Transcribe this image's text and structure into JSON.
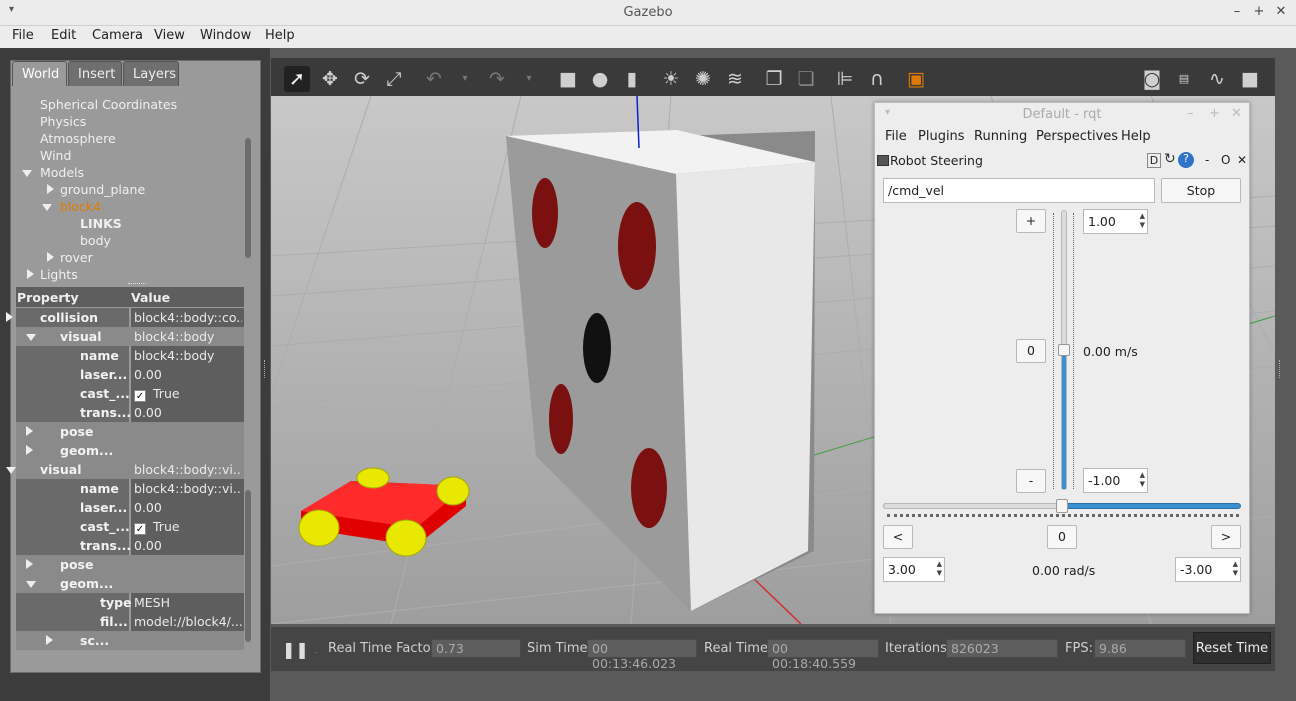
{
  "window": {
    "title": "Gazebo"
  },
  "menu": [
    "File",
    "Edit",
    "Camera",
    "View",
    "Window",
    "Help"
  ],
  "left_tabs": [
    "World",
    "Insert",
    "Layers"
  ],
  "tree": {
    "items": [
      "Spherical Coordinates",
      "Physics",
      "Atmosphere",
      "Wind",
      "Models",
      "ground_plane",
      "block4",
      "LINKS",
      "body",
      "rover",
      "Lights"
    ]
  },
  "props": {
    "header_property": "Property",
    "header_value": "Value",
    "rows": [
      {
        "k": "collision",
        "v": "block4::body::co..."
      },
      {
        "k": "visual",
        "v": "block4::body"
      },
      {
        "k": "name",
        "v": "block4::body"
      },
      {
        "k": "laser...",
        "v": "0.00"
      },
      {
        "k": "cast_...",
        "v": "True"
      },
      {
        "k": "trans...",
        "v": "0.00"
      },
      {
        "k": "pose",
        "v": ""
      },
      {
        "k": "geom...",
        "v": ""
      },
      {
        "k": "visual",
        "v": "block4::body::vi..."
      },
      {
        "k": "name",
        "v": "block4::body::vi..."
      },
      {
        "k": "laser...",
        "v": "0.00"
      },
      {
        "k": "cast_...",
        "v": "True"
      },
      {
        "k": "trans...",
        "v": "0.00"
      },
      {
        "k": "pose",
        "v": ""
      },
      {
        "k": "geom...",
        "v": ""
      },
      {
        "k": "type",
        "v": "MESH"
      },
      {
        "k": "fil...",
        "v": "model://block4/..."
      },
      {
        "k": "sc...",
        "v": ""
      }
    ]
  },
  "bottom": {
    "rtf_label": "Real Time Factor:",
    "rtf": "0.73",
    "sim_label": "Sim Time:",
    "sim": "00 00:13:46.023",
    "real_label": "Real Time:",
    "real": "00 00:18:40.559",
    "iter_label": "Iterations:",
    "iter": "826023",
    "fps_label": "FPS:",
    "fps": "9.86",
    "reset": "Reset Time"
  },
  "rqt": {
    "title": "Default - rqt",
    "menu": [
      "File",
      "Plugins",
      "Running",
      "Perspectives",
      "Help"
    ],
    "plugin": "Robot Steering",
    "topic": "/cmd_vel",
    "stop": "Stop",
    "plus": "+",
    "minus": "-",
    "zero": "0",
    "max_lin": "1.00",
    "min_lin": "-1.00",
    "lin_vel": "0.00 m/s",
    "left": "<",
    "right": ">",
    "zero2": "0",
    "max_ang": "3.00",
    "min_ang": "-3.00",
    "ang_vel": "0.00 rad/s",
    "controls": "D",
    "ctl_minus": "-",
    "ctl_o": "O",
    "ctl_x": "✕"
  },
  "colors": {
    "accent": "#e07b00",
    "slider": "#3a8fd0"
  }
}
